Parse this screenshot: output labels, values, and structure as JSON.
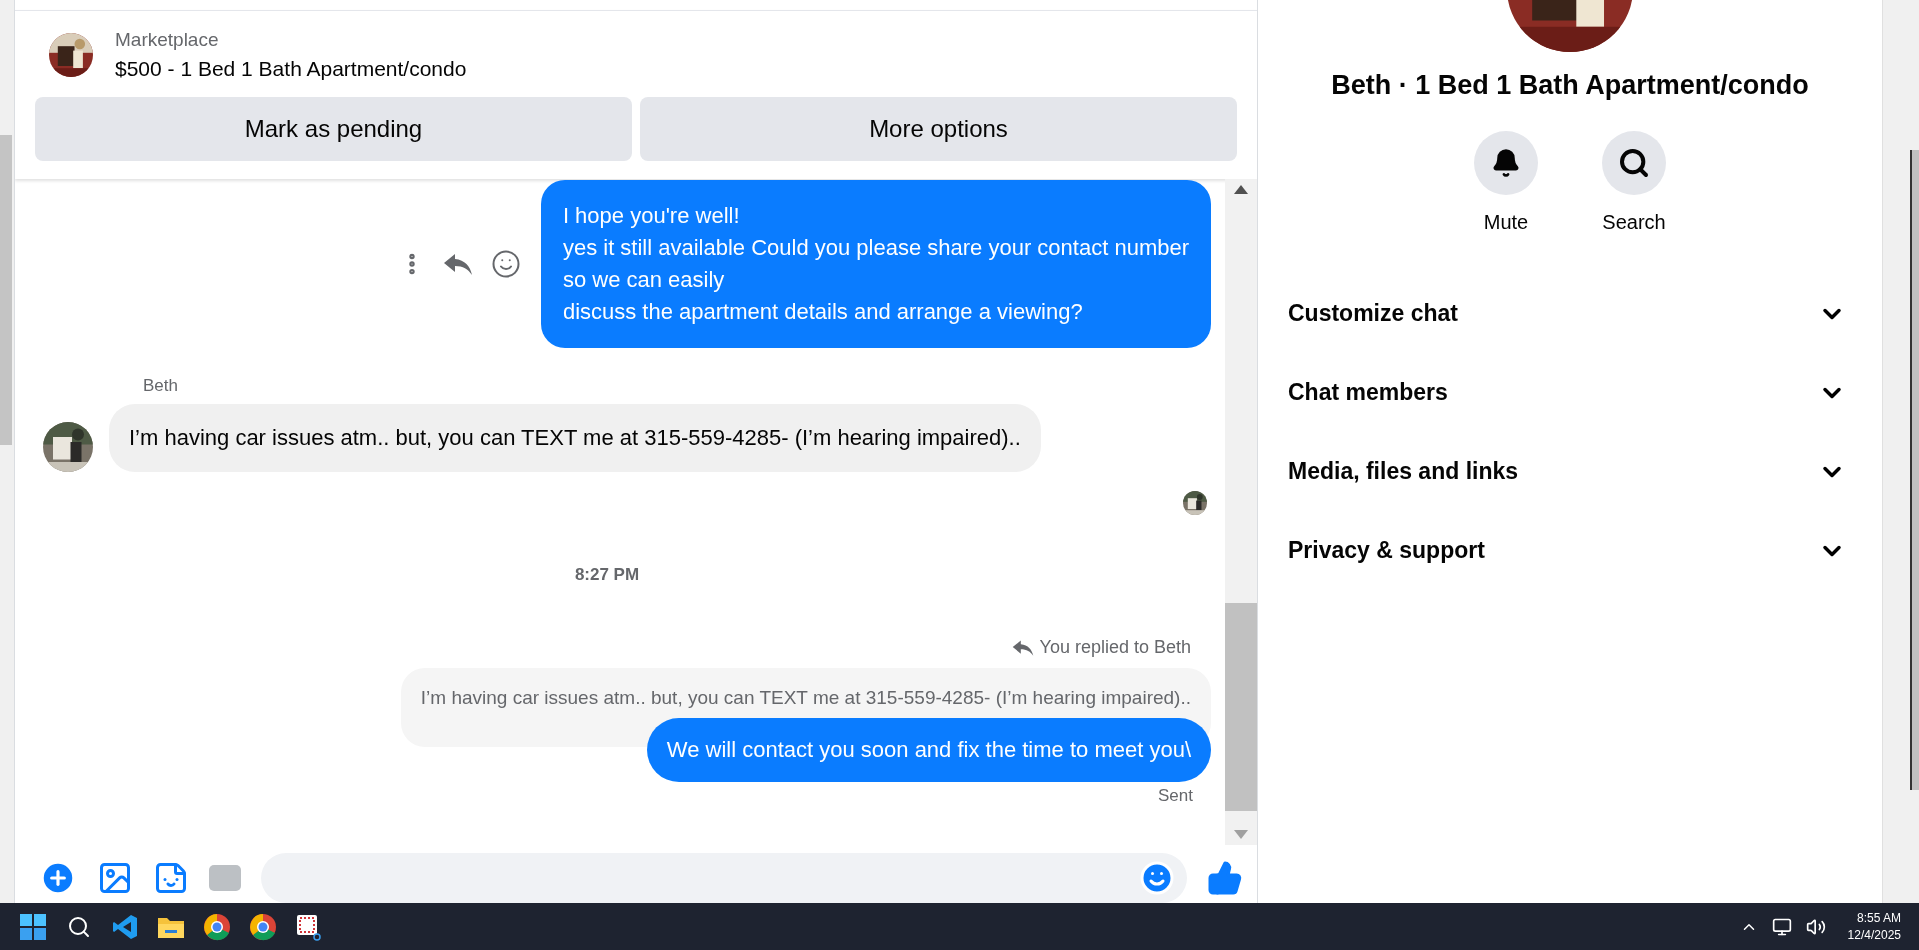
{
  "listing": {
    "source": "Marketplace",
    "title": "$500 - 1 Bed 1 Bath Apartment/condo",
    "actions": [
      "Mark as pending",
      "More options"
    ]
  },
  "messages": [
    {
      "kind": "sent",
      "lines": [
        "I hope you're well!",
        "yes it still available Could you please share your contact number",
        "so we can easily",
        "discuss the apartment details and arrange a viewing?"
      ]
    },
    {
      "kind": "received",
      "sender": "Beth",
      "text": "I’m having car issues atm.. but, you can TEXT me at 315-559-4285- (I’m hearing impaired).."
    },
    {
      "kind": "seen"
    },
    {
      "kind": "time",
      "text": "8:27 PM"
    },
    {
      "kind": "reply",
      "label": "You replied to Beth",
      "quote": "I’m having car issues atm.. but, you can TEXT me at 315-559-4285- (I’m hearing impaired)..",
      "text": "We will contact you soon and fix the time to meet you\\",
      "status": "Sent"
    }
  ],
  "details": {
    "title": "Beth · 1 Bed 1 Bath Apartment/condo",
    "actions": [
      {
        "kind": "mute",
        "label": "Mute"
      },
      {
        "kind": "search",
        "label": "Search"
      }
    ],
    "sections": [
      {
        "label": "Customize chat",
        "expanded": false
      },
      {
        "label": "Chat members",
        "expanded": false
      },
      {
        "label": "Media, files and links",
        "expanded": false
      },
      {
        "label": "Privacy & support",
        "expanded": false
      }
    ]
  },
  "taskbar": {
    "apps": [
      {
        "kind": "start"
      },
      {
        "kind": "search"
      },
      {
        "kind": "code"
      },
      {
        "kind": "folder"
      },
      {
        "kind": "browser"
      },
      {
        "kind": "browser"
      },
      {
        "kind": "snip"
      }
    ],
    "time": "8:55 AM",
    "date": "12/4/2025"
  }
}
